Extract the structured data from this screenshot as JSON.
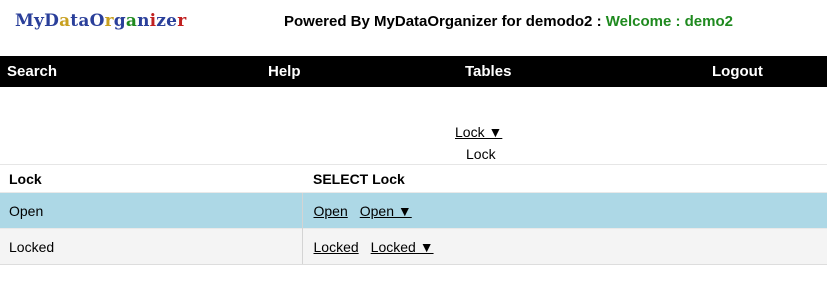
{
  "header": {
    "logo_letters": [
      {
        "ch": "M",
        "color": "#2a3f9a"
      },
      {
        "ch": "y",
        "color": "#2a3f9a"
      },
      {
        "ch": "D",
        "color": "#2a3f9a"
      },
      {
        "ch": "a",
        "color": "#c8a020"
      },
      {
        "ch": "t",
        "color": "#2a3f9a"
      },
      {
        "ch": "a",
        "color": "#2a3f9a"
      },
      {
        "ch": "O",
        "color": "#2a3f9a"
      },
      {
        "ch": "r",
        "color": "#c8a020"
      },
      {
        "ch": "g",
        "color": "#2a3f9a"
      },
      {
        "ch": "a",
        "color": "#1f8a1f"
      },
      {
        "ch": "n",
        "color": "#2a3f9a"
      },
      {
        "ch": "i",
        "color": "#c02020"
      },
      {
        "ch": "z",
        "color": "#2a3f9a"
      },
      {
        "ch": "e",
        "color": "#2a3f9a"
      },
      {
        "ch": "r",
        "color": "#c02020"
      }
    ],
    "powered_text": "Powered By MyDataOrganizer for demodo2 : ",
    "welcome_text": "Welcome : demo2",
    "welcome_color": "#1f8a1f"
  },
  "nav": {
    "search": "Search",
    "help": "Help",
    "tables": "Tables",
    "logout": "Logout",
    "background": "#000000"
  },
  "filter": {
    "link_label": "Lock ▼ ",
    "label": "Lock"
  },
  "table": {
    "headers": [
      "Lock",
      "SELECT Lock"
    ],
    "rows": [
      {
        "value": "Open",
        "link": "Open",
        "dropdown": "Open ▼"
      },
      {
        "value": "Locked",
        "link": "Locked",
        "dropdown": "Locked ▼"
      }
    ],
    "highlight_color": "#add8e6"
  }
}
